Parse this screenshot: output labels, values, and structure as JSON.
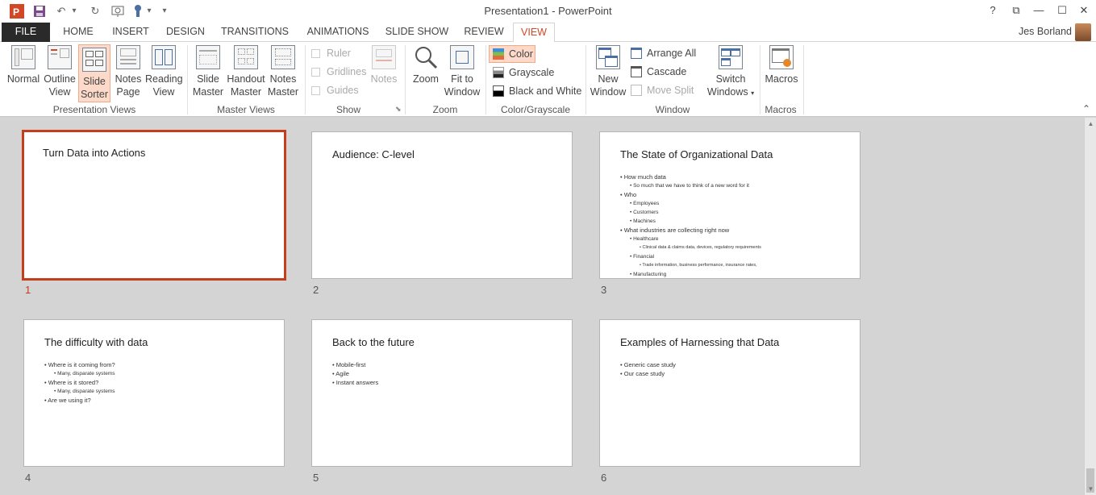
{
  "window": {
    "title": "Presentation1 - PowerPoint",
    "help": "?",
    "restore_ribbon": "⧉",
    "minimize": "—",
    "maximize": "☐",
    "close": "✕"
  },
  "quick_access": {
    "undo": "↶",
    "undo_dropdown": "▾",
    "redo": "↻",
    "customize": "▾"
  },
  "tabs": [
    "FILE",
    "HOME",
    "INSERT",
    "DESIGN",
    "TRANSITIONS",
    "ANIMATIONS",
    "SLIDE SHOW",
    "REVIEW",
    "VIEW"
  ],
  "user": {
    "name": "Jes Borland",
    "dropdown": "▾"
  },
  "ribbon": {
    "presentation_views": {
      "label": "Presentation Views",
      "normal": "Normal",
      "outline": [
        "Outline",
        "View"
      ],
      "slide_sorter": [
        "Slide",
        "Sorter"
      ],
      "notes_page": [
        "Notes",
        "Page"
      ],
      "reading": [
        "Reading",
        "View"
      ]
    },
    "master_views": {
      "label": "Master Views",
      "slide_master": [
        "Slide",
        "Master"
      ],
      "handout_master": [
        "Handout",
        "Master"
      ],
      "notes_master": [
        "Notes",
        "Master"
      ]
    },
    "show": {
      "label": "Show",
      "ruler": "Ruler",
      "gridlines": "Gridlines",
      "guides": "Guides",
      "notes": "Notes",
      "launcher": "⬊"
    },
    "zoom": {
      "label": "Zoom",
      "zoom": "Zoom",
      "fit": [
        "Fit to",
        "Window"
      ]
    },
    "color": {
      "label": "Color/Grayscale",
      "color": "Color",
      "grayscale": "Grayscale",
      "bw": "Black and White"
    },
    "window": {
      "label": "Window",
      "new_window": [
        "New",
        "Window"
      ],
      "arrange_all": "Arrange All",
      "cascade": "Cascade",
      "move_split": "Move Split",
      "switch": [
        "Switch",
        "Windows"
      ],
      "switch_dropdown": "▾"
    },
    "macros": {
      "label": "Macros",
      "macros": "Macros",
      "collapse": "⌃"
    }
  },
  "colors": {
    "accent": "#d24726",
    "selected_border": "#c43e1c",
    "active_button": "#fcd9c9"
  },
  "slides": [
    {
      "num": "1",
      "title": "Turn Data into Actions",
      "bullets": []
    },
    {
      "num": "2",
      "title": "Audience: C-level",
      "bullets": []
    },
    {
      "num": "3",
      "title": "The State of Organizational Data",
      "bullets": [
        {
          "level": 1,
          "text": "How much data"
        },
        {
          "level": 2,
          "text": "So much that we have to think of a new word for it"
        },
        {
          "level": 1,
          "text": "Who"
        },
        {
          "level": 2,
          "text": "Employees"
        },
        {
          "level": 2,
          "text": "Customers"
        },
        {
          "level": 2,
          "text": "Machines"
        },
        {
          "level": 1,
          "text": "What industries are collecting right now"
        },
        {
          "level": 2,
          "text": "Healthcare"
        },
        {
          "level": 3,
          "text": "Clinical data & claims data, devices, regulatory requirements"
        },
        {
          "level": 2,
          "text": "Financial"
        },
        {
          "level": 3,
          "text": "Trade information, business performance, insurance rates,"
        },
        {
          "level": 2,
          "text": "Manufacturing"
        }
      ]
    },
    {
      "num": "4",
      "title": "The difficulty with data",
      "bullets": [
        {
          "level": 1,
          "text": "Where is it coming from?"
        },
        {
          "level": 2,
          "text": "Many, disparate systems"
        },
        {
          "level": 1,
          "text": "Where is it stored?"
        },
        {
          "level": 2,
          "text": "Many, disparate systems"
        },
        {
          "level": 1,
          "text": "Are we using it?"
        }
      ]
    },
    {
      "num": "5",
      "title": "Back to the future",
      "bullets": [
        {
          "level": 1,
          "text": "Mobile-first"
        },
        {
          "level": 1,
          "text": "Agile"
        },
        {
          "level": 1,
          "text": "Instant answers"
        }
      ]
    },
    {
      "num": "6",
      "title": "Examples of Harnessing that Data",
      "bullets": [
        {
          "level": 1,
          "text": "Generic case study"
        },
        {
          "level": 1,
          "text": "Our case study"
        }
      ]
    }
  ],
  "scroll": {
    "up": "▲",
    "down": "▼"
  }
}
